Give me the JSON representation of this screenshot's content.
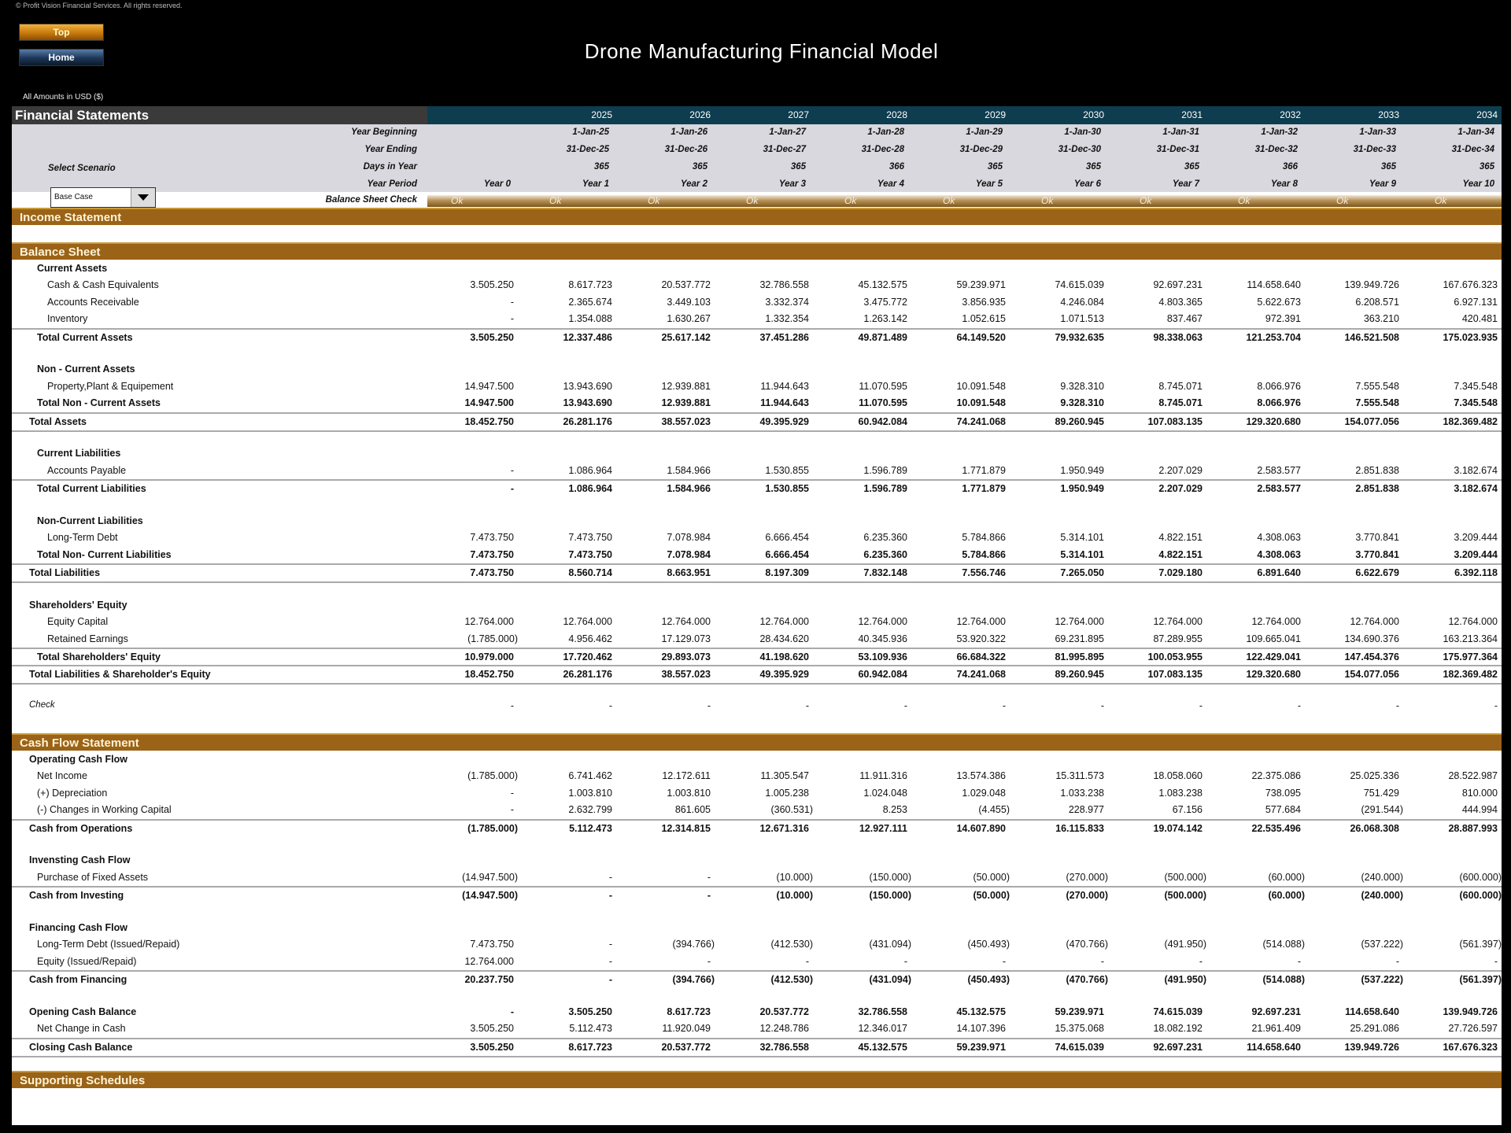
{
  "copyright": "© Profit Vision Financial Services. All rights reserved.",
  "nav": {
    "top_label": "Top",
    "home_label": "Home"
  },
  "title": "Drone Manufacturing Financial Model",
  "units": "All Amounts in  USD ($)",
  "header": {
    "sheet_title": "Financial Statements",
    "years": [
      "2025",
      "2026",
      "2027",
      "2028",
      "2029",
      "2030",
      "2031",
      "2032",
      "2033",
      "2034"
    ],
    "labels": {
      "year_beginning": "Year Beginning",
      "year_ending": "Year Ending",
      "days_in_year": "Days in Year",
      "year_period": "Year Period",
      "balance_sheet_check": "Balance Sheet Check"
    },
    "year_beginning": [
      "1-Jan-25",
      "1-Jan-26",
      "1-Jan-27",
      "1-Jan-28",
      "1-Jan-29",
      "1-Jan-30",
      "1-Jan-31",
      "1-Jan-32",
      "1-Jan-33",
      "1-Jan-34"
    ],
    "year_ending": [
      "31-Dec-25",
      "31-Dec-26",
      "31-Dec-27",
      "31-Dec-28",
      "31-Dec-29",
      "31-Dec-30",
      "31-Dec-31",
      "31-Dec-32",
      "31-Dec-33",
      "31-Dec-34"
    ],
    "days_in_year": [
      "365",
      "365",
      "365",
      "366",
      "365",
      "365",
      "365",
      "366",
      "365",
      "365"
    ],
    "year_period": [
      "Year 0",
      "Year 1",
      "Year 2",
      "Year 3",
      "Year 4",
      "Year 5",
      "Year 6",
      "Year 7",
      "Year 8",
      "Year 9",
      "Year 10"
    ],
    "balance_check": [
      "Ok",
      "Ok",
      "Ok",
      "Ok",
      "Ok",
      "Ok",
      "Ok",
      "Ok",
      "Ok",
      "Ok",
      "Ok"
    ]
  },
  "scenario": {
    "label": "Select Scenario",
    "selected": "Base Case"
  },
  "sections": {
    "income_statement": "Income Statement",
    "balance_sheet": "Balance Sheet",
    "cash_flow": "Cash Flow Statement",
    "supporting": "Supporting Schedules"
  },
  "balance_sheet": [
    {
      "label": "Current Assets",
      "style": "bold",
      "indent": 1,
      "values": []
    },
    {
      "label": "Cash & Cash Equivalents",
      "indent": 2,
      "values": [
        "3.505.250",
        "8.617.723",
        "20.537.772",
        "32.786.558",
        "45.132.575",
        "59.239.971",
        "74.615.039",
        "92.697.231",
        "114.658.640",
        "139.949.726",
        "167.676.323"
      ]
    },
    {
      "label": "Accounts Receivable",
      "indent": 2,
      "values": [
        "-",
        "2.365.674",
        "3.449.103",
        "3.332.374",
        "3.475.772",
        "3.856.935",
        "4.246.084",
        "4.803.365",
        "5.622.673",
        "6.208.571",
        "6.927.131"
      ]
    },
    {
      "label": "Inventory",
      "indent": 2,
      "values": [
        "-",
        "1.354.088",
        "1.630.267",
        "1.332.354",
        "1.263.142",
        "1.052.615",
        "1.071.513",
        "837.467",
        "972.391",
        "363.210",
        "420.481"
      ]
    },
    {
      "label": "Total Current Assets",
      "style": "bold",
      "indent": 1,
      "line": "top",
      "values": [
        "3.505.250",
        "12.337.486",
        "25.617.142",
        "37.451.286",
        "49.871.489",
        "64.149.520",
        "79.932.635",
        "98.338.063",
        "121.253.704",
        "146.521.508",
        "175.023.935"
      ]
    },
    {
      "label": "",
      "values": []
    },
    {
      "label": "Non - Current Assets",
      "style": "bold",
      "indent": 1,
      "values": []
    },
    {
      "label": "Property,Plant & Equipement",
      "indent": 2,
      "values": [
        "14.947.500",
        "13.943.690",
        "12.939.881",
        "11.944.643",
        "11.070.595",
        "10.091.548",
        "9.328.310",
        "8.745.071",
        "8.066.976",
        "7.555.548",
        "7.345.548"
      ]
    },
    {
      "label": "Total Non - Current Assets",
      "style": "bold",
      "indent": 1,
      "values": [
        "14.947.500",
        "13.943.690",
        "12.939.881",
        "11.944.643",
        "11.070.595",
        "10.091.548",
        "9.328.310",
        "8.745.071",
        "8.066.976",
        "7.555.548",
        "7.345.548"
      ]
    },
    {
      "label": "Total Assets",
      "style": "bold",
      "indent": 0,
      "line": "both",
      "values": [
        "18.452.750",
        "26.281.176",
        "38.557.023",
        "49.395.929",
        "60.942.084",
        "74.241.068",
        "89.260.945",
        "107.083.135",
        "129.320.680",
        "154.077.056",
        "182.369.482"
      ]
    },
    {
      "label": "",
      "values": []
    },
    {
      "label": "Current Liabilities",
      "style": "bold",
      "indent": 1,
      "values": []
    },
    {
      "label": "Accounts Payable",
      "indent": 2,
      "values": [
        "-",
        "1.086.964",
        "1.584.966",
        "1.530.855",
        "1.596.789",
        "1.771.879",
        "1.950.949",
        "2.207.029",
        "2.583.577",
        "2.851.838",
        "3.182.674"
      ]
    },
    {
      "label": "Total Current Liabilities",
      "style": "bold",
      "indent": 1,
      "line": "top",
      "values": [
        "-",
        "1.086.964",
        "1.584.966",
        "1.530.855",
        "1.596.789",
        "1.771.879",
        "1.950.949",
        "2.207.029",
        "2.583.577",
        "2.851.838",
        "3.182.674"
      ]
    },
    {
      "label": "",
      "values": []
    },
    {
      "label": "Non-Current Liabilities",
      "style": "bold",
      "indent": 1,
      "values": []
    },
    {
      "label": "Long-Term Debt",
      "indent": 2,
      "values": [
        "7.473.750",
        "7.473.750",
        "7.078.984",
        "6.666.454",
        "6.235.360",
        "5.784.866",
        "5.314.101",
        "4.822.151",
        "4.308.063",
        "3.770.841",
        "3.209.444"
      ]
    },
    {
      "label": "Total Non- Current Liabilities",
      "style": "bold",
      "indent": 1,
      "values": [
        "7.473.750",
        "7.473.750",
        "7.078.984",
        "6.666.454",
        "6.235.360",
        "5.784.866",
        "5.314.101",
        "4.822.151",
        "4.308.063",
        "3.770.841",
        "3.209.444"
      ]
    },
    {
      "label": "Total Liabilities",
      "style": "bold",
      "indent": 0,
      "line": "both",
      "values": [
        "7.473.750",
        "8.560.714",
        "8.663.951",
        "8.197.309",
        "7.832.148",
        "7.556.746",
        "7.265.050",
        "7.029.180",
        "6.891.640",
        "6.622.679",
        "6.392.118"
      ]
    },
    {
      "label": "",
      "values": []
    },
    {
      "label": "Shareholders' Equity",
      "style": "bold",
      "indent": 0,
      "values": []
    },
    {
      "label": "Equity Capital",
      "indent": 2,
      "values": [
        "12.764.000",
        "12.764.000",
        "12.764.000",
        "12.764.000",
        "12.764.000",
        "12.764.000",
        "12.764.000",
        "12.764.000",
        "12.764.000",
        "12.764.000",
        "12.764.000"
      ]
    },
    {
      "label": "Retained Earnings",
      "indent": 2,
      "values": [
        "(1.785.000)",
        "4.956.462",
        "17.129.073",
        "28.434.620",
        "40.345.936",
        "53.920.322",
        "69.231.895",
        "87.289.955",
        "109.665.041",
        "134.690.376",
        "163.213.364"
      ]
    },
    {
      "label": "Total Shareholders' Equity",
      "style": "bold",
      "indent": 1,
      "line": "top",
      "values": [
        "10.979.000",
        "17.720.462",
        "29.893.073",
        "41.198.620",
        "53.109.936",
        "66.684.322",
        "81.995.895",
        "100.053.955",
        "122.429.041",
        "147.454.376",
        "175.977.364"
      ]
    },
    {
      "label": "Total Liabilities & Shareholder's Equity",
      "style": "bold",
      "indent": 0,
      "line": "both",
      "values": [
        "18.452.750",
        "26.281.176",
        "38.557.023",
        "49.395.929",
        "60.942.084",
        "74.241.068",
        "89.260.945",
        "107.083.135",
        "129.320.680",
        "154.077.056",
        "182.369.482"
      ]
    },
    {
      "label": "",
      "values": []
    },
    {
      "label": "Check",
      "style": "italic",
      "indent": 0,
      "values": [
        "-",
        "-",
        "-",
        "-",
        "-",
        "-",
        "-",
        "-",
        "-",
        "-",
        "-"
      ]
    }
  ],
  "cash_flow": [
    {
      "label": "Operating Cash Flow",
      "style": "bold",
      "indent": 0,
      "values": []
    },
    {
      "label": "Net Income",
      "indent": 1,
      "values": [
        "(1.785.000)",
        "6.741.462",
        "12.172.611",
        "11.305.547",
        "11.911.316",
        "13.574.386",
        "15.311.573",
        "18.058.060",
        "22.375.086",
        "25.025.336",
        "28.522.987"
      ]
    },
    {
      "label": "(+) Depreciation",
      "indent": 1,
      "values": [
        "-",
        "1.003.810",
        "1.003.810",
        "1.005.238",
        "1.024.048",
        "1.029.048",
        "1.033.238",
        "1.083.238",
        "738.095",
        "751.429",
        "810.000"
      ]
    },
    {
      "label": "(-) Changes in Working Capital",
      "indent": 1,
      "values": [
        "-",
        "2.632.799",
        "861.605",
        "(360.531)",
        "8.253",
        "(4.455)",
        "228.977",
        "67.156",
        "577.684",
        "(291.544)",
        "444.994"
      ]
    },
    {
      "label": "Cash from Operations",
      "style": "bold",
      "indent": 0,
      "line": "top",
      "values": [
        "(1.785.000)",
        "5.112.473",
        "12.314.815",
        "12.671.316",
        "12.927.111",
        "14.607.890",
        "16.115.833",
        "19.074.142",
        "22.535.496",
        "26.068.308",
        "28.887.993"
      ]
    },
    {
      "label": "",
      "values": []
    },
    {
      "label": "Invensting Cash Flow",
      "style": "bold",
      "indent": 0,
      "values": []
    },
    {
      "label": "Purchase of Fixed Assets",
      "indent": 1,
      "values": [
        "(14.947.500)",
        "-",
        "-",
        "(10.000)",
        "(150.000)",
        "(50.000)",
        "(270.000)",
        "(500.000)",
        "(60.000)",
        "(240.000)",
        "(600.000)"
      ]
    },
    {
      "label": "Cash from Investing",
      "style": "bold",
      "indent": 0,
      "line": "top",
      "values": [
        "(14.947.500)",
        "-",
        "-",
        "(10.000)",
        "(150.000)",
        "(50.000)",
        "(270.000)",
        "(500.000)",
        "(60.000)",
        "(240.000)",
        "(600.000)"
      ]
    },
    {
      "label": "",
      "values": []
    },
    {
      "label": "Financing Cash Flow",
      "style": "bold",
      "indent": 0,
      "values": []
    },
    {
      "label": "Long-Term Debt (Issued/Repaid)",
      "indent": 1,
      "values": [
        "7.473.750",
        "-",
        "(394.766)",
        "(412.530)",
        "(431.094)",
        "(450.493)",
        "(470.766)",
        "(491.950)",
        "(514.088)",
        "(537.222)",
        "(561.397)"
      ]
    },
    {
      "label": "Equity (Issued/Repaid)",
      "indent": 1,
      "values": [
        "12.764.000",
        "-",
        "-",
        "-",
        "-",
        "-",
        "-",
        "-",
        "-",
        "-",
        "-"
      ]
    },
    {
      "label": "Cash from Financing",
      "style": "bold",
      "indent": 0,
      "line": "top",
      "values": [
        "20.237.750",
        "-",
        "(394.766)",
        "(412.530)",
        "(431.094)",
        "(450.493)",
        "(470.766)",
        "(491.950)",
        "(514.088)",
        "(537.222)",
        "(561.397)"
      ]
    },
    {
      "label": "",
      "values": []
    },
    {
      "label": "Opening Cash Balance",
      "style": "bold",
      "indent": 0,
      "values": [
        "-",
        "3.505.250",
        "8.617.723",
        "20.537.772",
        "32.786.558",
        "45.132.575",
        "59.239.971",
        "74.615.039",
        "92.697.231",
        "114.658.640",
        "139.949.726"
      ]
    },
    {
      "label": "Net Change in Cash",
      "indent": 1,
      "values": [
        "3.505.250",
        "5.112.473",
        "11.920.049",
        "12.248.786",
        "12.346.017",
        "14.107.396",
        "15.375.068",
        "18.082.192",
        "21.961.409",
        "25.291.086",
        "27.726.597"
      ]
    },
    {
      "label": "Closing Cash Balance",
      "style": "bold",
      "indent": 0,
      "line": "both",
      "values": [
        "3.505.250",
        "8.617.723",
        "20.537.772",
        "32.786.558",
        "45.132.575",
        "59.239.971",
        "74.615.039",
        "92.697.231",
        "114.658.640",
        "139.949.726",
        "167.676.323"
      ]
    }
  ]
}
